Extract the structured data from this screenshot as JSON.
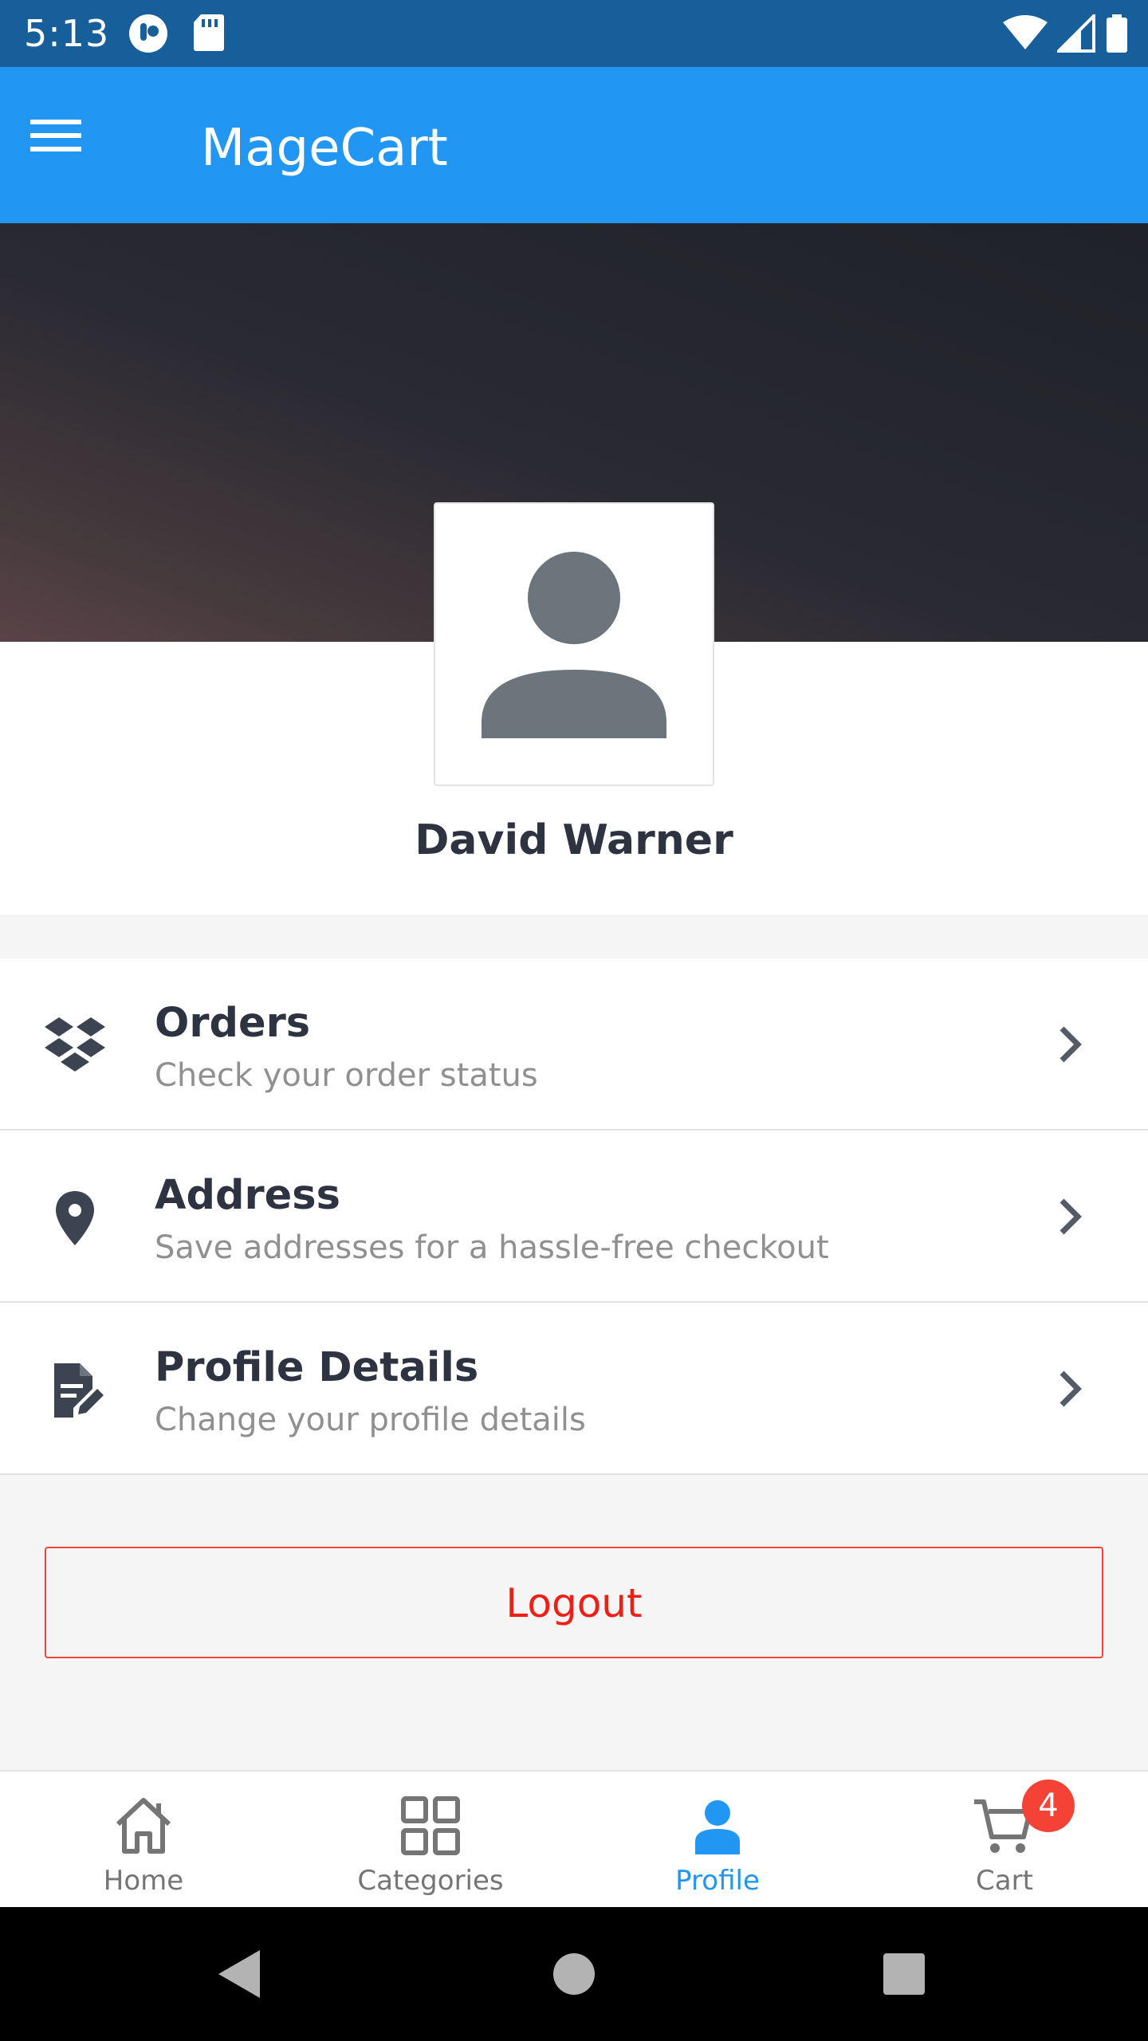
{
  "status_bar": {
    "time": "5:13",
    "left_icons": [
      "camera-app-icon",
      "sd-card-icon"
    ],
    "right_icons": [
      "wifi-icon",
      "cell-signal-icon",
      "battery-icon"
    ]
  },
  "app_bar": {
    "title": "MageCart",
    "menu_icon": "hamburger-menu-icon"
  },
  "profile": {
    "name": "David Warner",
    "avatar_icon": "person-icon"
  },
  "menu": {
    "items": [
      {
        "title": "Orders",
        "subtitle": "Check your order status",
        "icon": "dropbox-icon"
      },
      {
        "title": "Address",
        "subtitle": "Save addresses for a hassle-free checkout",
        "icon": "location-pin-icon"
      },
      {
        "title": "Profile Details",
        "subtitle": "Change your profile details",
        "icon": "edit-document-icon"
      }
    ]
  },
  "logout": {
    "label": "Logout"
  },
  "bottom_nav": {
    "items": [
      {
        "label": "Home",
        "icon": "home-icon"
      },
      {
        "label": "Categories",
        "icon": "grid-icon"
      },
      {
        "label": "Profile",
        "icon": "person-icon",
        "active": true
      },
      {
        "label": "Cart",
        "icon": "cart-icon",
        "badge": "4"
      }
    ]
  },
  "colors": {
    "status_bar": "#165f9b",
    "app_bar": "#2196f3",
    "accent": "#2196f3",
    "logout": "#f44336",
    "title_text": "#2d3340",
    "subtitle_text": "#909090"
  }
}
